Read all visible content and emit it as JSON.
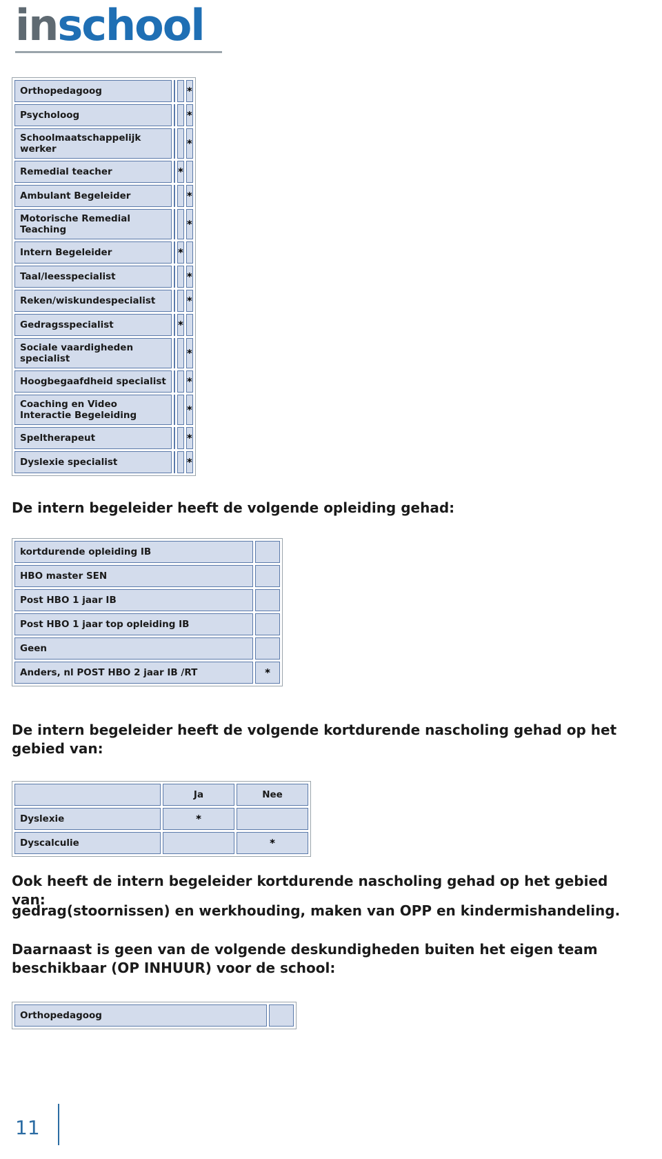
{
  "logo": {
    "part1": "in",
    "part2": "school"
  },
  "specialists_table": {
    "name": "deskundigheden-binnen-team",
    "rows": [
      {
        "label": "Orthopedagoog",
        "c1": "",
        "c2": "",
        "c3": "*"
      },
      {
        "label": "Psycholoog",
        "c1": "",
        "c2": "",
        "c3": "*"
      },
      {
        "label": "Schoolmaatschappelijk werker",
        "c1": "",
        "c2": "",
        "c3": "*"
      },
      {
        "label": "Remedial teacher",
        "c1": "",
        "c2": "*",
        "c3": ""
      },
      {
        "label": "Ambulant Begeleider",
        "c1": "",
        "c2": "",
        "c3": "*"
      },
      {
        "label": "Motorische Remedial Teaching",
        "c1": "",
        "c2": "",
        "c3": "*"
      },
      {
        "label": "Intern Begeleider",
        "c1": "",
        "c2": "*",
        "c3": ""
      },
      {
        "label": "Taal/leesspecialist",
        "c1": "",
        "c2": "",
        "c3": "*"
      },
      {
        "label": "Reken/wiskundespecialist",
        "c1": "",
        "c2": "",
        "c3": "*"
      },
      {
        "label": "Gedragsspecialist",
        "c1": "",
        "c2": "*",
        "c3": ""
      },
      {
        "label": "Sociale vaardigheden specialist",
        "c1": "",
        "c2": "",
        "c3": "*"
      },
      {
        "label": "Hoogbegaafdheid specialist",
        "c1": "",
        "c2": "",
        "c3": "*"
      },
      {
        "label": "Coaching en Video Interactie Begeleiding",
        "c1": "",
        "c2": "",
        "c3": "*"
      },
      {
        "label": "Speltherapeut",
        "c1": "",
        "c2": "",
        "c3": "*"
      },
      {
        "label": "Dyslexie specialist",
        "c1": "",
        "c2": "",
        "c3": "*"
      }
    ]
  },
  "heading_opleiding": "De intern begeleider heeft de volgende opleiding gehad:",
  "opleiding_table": {
    "name": "opleiding-ib",
    "rows": [
      {
        "label": "kortdurende opleiding IB",
        "c1": ""
      },
      {
        "label": "HBO master SEN",
        "c1": ""
      },
      {
        "label": "Post HBO 1 jaar IB",
        "c1": ""
      },
      {
        "label": "Post HBO 1 jaar top opleiding IB",
        "c1": ""
      },
      {
        "label": "Geen",
        "c1": ""
      },
      {
        "label": "Anders, nl POST HBO 2 jaar IB /RT",
        "c1": "*"
      }
    ]
  },
  "heading_nascholing": "De intern begeleider heeft de volgende kortdurende nascholing gehad op het gebied van:",
  "nascholing_table": {
    "name": "nascholing-ib",
    "header": {
      "label": "",
      "ja": "Ja",
      "nee": "Nee"
    },
    "rows": [
      {
        "label": "Dyslexie",
        "ja": "*",
        "nee": ""
      },
      {
        "label": "Dyscalculie",
        "ja": "",
        "nee": "*"
      }
    ]
  },
  "para_ook": "Ook heeft de intern begeleider kortdurende nascholing gehad op het gebied van:",
  "para_gedrag": "gedrag(stoornissen) en werkhouding, maken van OPP en kindermishandeling.",
  "para_daarnaast": "Daarnaast is geen van de volgende deskundigheden buiten het eigen team beschikbaar (OP INHUUR) voor de school:",
  "inhuur_table": {
    "name": "deskundigheden-op-inhuur",
    "rows": [
      {
        "label": "Orthopedagoog",
        "c1": ""
      }
    ]
  },
  "footer": {
    "page_number": "11"
  }
}
